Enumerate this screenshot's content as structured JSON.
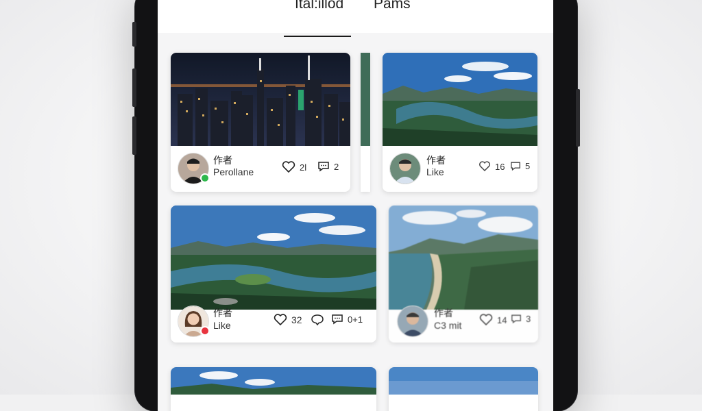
{
  "tabs": [
    {
      "label": "Ital:illod",
      "active": true
    },
    {
      "label": "Pams",
      "active": false
    }
  ],
  "cards": [
    {
      "author": "作者",
      "subtitle": "Perollane",
      "likes": "2l",
      "comments": "2",
      "status": "online"
    },
    {
      "author": "作者",
      "subtitle": "Like",
      "likes": "16",
      "comments": "5"
    },
    {
      "author": "作者",
      "subtitle": "Like",
      "likes": "32",
      "comments": "0+1",
      "status": "busy"
    },
    {
      "author": "作者",
      "subtitle": "C3 mit",
      "likes": "14",
      "comments": "3"
    }
  ],
  "colors": {
    "status_online": "#2eb84b",
    "status_busy": "#e8343f",
    "tab_underline": "#1a1a1a"
  },
  "icons": [
    "heart-icon",
    "comment-icon"
  ]
}
